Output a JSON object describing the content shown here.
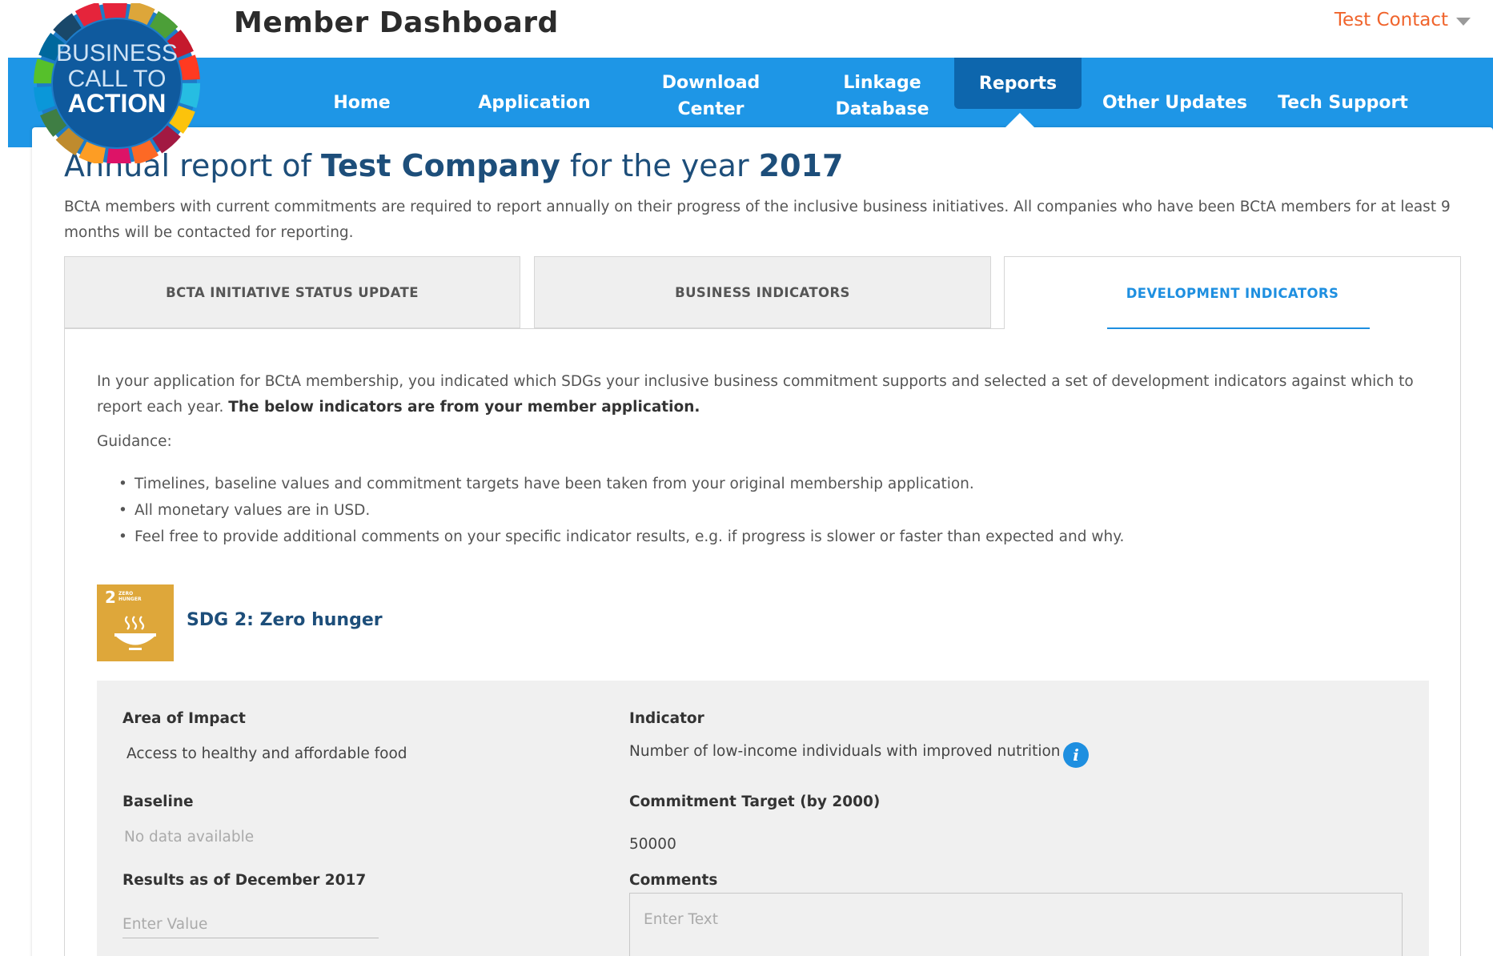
{
  "header": {
    "title": "Member Dashboard",
    "user_name": "Test Contact"
  },
  "logo": {
    "line1": "BUSINESS",
    "line2": "CALL TO",
    "line3": "ACTION"
  },
  "nav": {
    "items": [
      {
        "label": "Home"
      },
      {
        "label": "Application"
      },
      {
        "label": "Download Center",
        "line1": "Download",
        "line2": "Center"
      },
      {
        "label": "Linkage Database",
        "line1": "Linkage",
        "line2": "Database"
      },
      {
        "label": "Reports",
        "active": true
      },
      {
        "label": "Other Updates"
      },
      {
        "label": "Tech Support"
      }
    ]
  },
  "report": {
    "title_prefix": "Annual report of ",
    "company": "Test Company",
    "title_mid": " for the year ",
    "year": "2017",
    "intro": "BCtA members with current commitments are required to report annually on their progress of the inclusive business initiatives. All companies who have been BCtA members for at least 9 months will be contacted for reporting."
  },
  "tabs": [
    {
      "label": "BCTA INITIATIVE STATUS UPDATE",
      "active": false
    },
    {
      "label": "BUSINESS INDICATORS",
      "active": false
    },
    {
      "label": "DEVELOPMENT INDICATORS",
      "active": true
    }
  ],
  "panel": {
    "intro_text": "In your application for BCtA membership, you indicated which SDGs your inclusive business commitment supports and selected a set of development indicators against which to report each year. ",
    "intro_bold": "The below indicators are from your member application.",
    "guidance_label": "Guidance:",
    "guidance": [
      "Timelines, baseline values and commitment targets have been taken from your original membership application.",
      "All monetary values are in USD.",
      "Feel free to provide additional comments on your specific indicator results, e.g. if progress is slower or faster than expected and why."
    ]
  },
  "sdg": {
    "number": "2",
    "tile_text_1": "ZERO",
    "tile_text_2": "HUNGER",
    "name": "SDG 2: Zero hunger",
    "tile_color": "#dea73a"
  },
  "indicator": {
    "area_label": "Area of Impact",
    "area_value": "Access to healthy and affordable food",
    "indicator_label": "Indicator",
    "indicator_value": "Number of low-income individuals with improved nutrition",
    "info_icon": "i",
    "baseline_label": "Baseline",
    "baseline_value": "No data available",
    "target_label": "Commitment Target (by 2000)",
    "target_value": "50000",
    "results_label": "Results as of December 2017",
    "results_placeholder": "Enter Value",
    "comments_label": "Comments",
    "comments_placeholder": "Enter Text"
  },
  "colors": {
    "nav_blue": "#1e96e6",
    "nav_active": "#0d66ad",
    "title_navy": "#1d4e7a",
    "accent_orange": "#f0642c",
    "tab_active_blue": "#1e8fe0"
  }
}
